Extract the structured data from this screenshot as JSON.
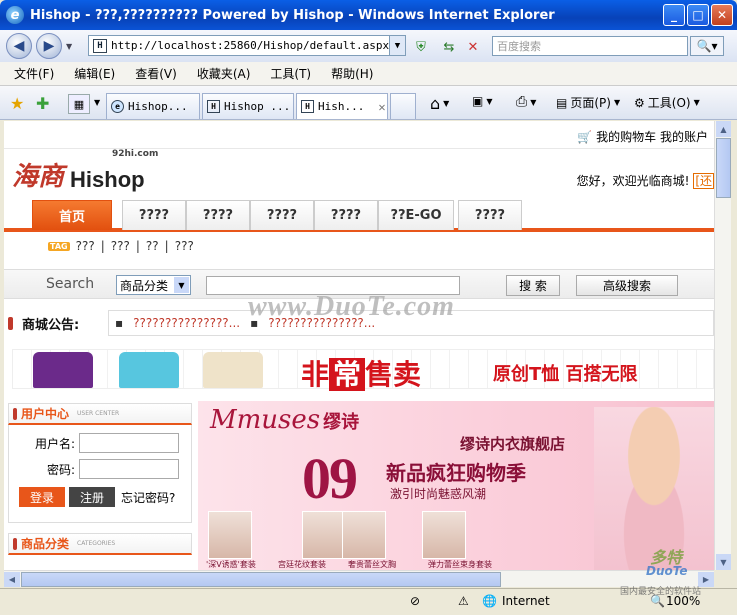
{
  "window": {
    "title": "Hishop - ???,?????????? Powered by Hishop - Windows Internet Explorer",
    "buttons": [
      "_",
      "□",
      "✕"
    ]
  },
  "address_bar": {
    "url": "http://localhost:25860/Hishop/default.aspx",
    "search_placeholder": "百度搜索"
  },
  "menu": [
    "文件(F)",
    "编辑(E)",
    "查看(V)",
    "收藏夹(A)",
    "工具(T)",
    "帮助(H)"
  ],
  "tabs": [
    {
      "label": "Hishop..."
    },
    {
      "label": "Hishop ..."
    },
    {
      "label": "Hish..."
    }
  ],
  "toolbar": {
    "page_label": "页面(P)",
    "tools_label": "工具(O)"
  },
  "site": {
    "top_links": {
      "cart": "我的购物车",
      "account": "我的账户"
    },
    "logo": {
      "cn": "海商",
      "en": "Hishop",
      "domain": "92hi.com"
    },
    "welcome": "您好，欢迎光临商城!",
    "welcome_cut": "[还",
    "nav": [
      "首页",
      "????",
      "????",
      "????",
      "????",
      "??E-GO",
      "????"
    ],
    "tag_badge": "TAG",
    "tags": [
      "???",
      "???",
      "??",
      "???"
    ],
    "search": {
      "label": "Search",
      "category": "商品分类",
      "search_button": "搜 索",
      "advanced_button": "高级搜索"
    },
    "notice": {
      "title": "商城公告:",
      "items": [
        "???????????????...",
        "???????????????..."
      ]
    },
    "banner1": {
      "main": "非",
      "boxed": "常",
      "tail": "售卖",
      "sub": "原创T恤  百搭无限"
    },
    "user_center": {
      "title": "用户中心",
      "title_en": "USER CENTER",
      "username_label": "用户名:",
      "password_label": "密码:",
      "login_button": "登录",
      "register_button": "注册",
      "forgot": "忘记密码?"
    },
    "categories": {
      "title": "商品分类",
      "title_en": "CATEGORIES"
    },
    "promo": {
      "brand": "Mmuses",
      "brand_cn": "缪诗",
      "store": "缪诗内衣旗舰店",
      "big": "09",
      "headline": "新品疯狂购物季",
      "sub": "激引时尚魅惑风潮",
      "captions": [
        "'深V诱惑'套装",
        "宫廷花纹套装",
        "奢贵蕾丝文胸",
        "弹力蕾丝束身套装"
      ]
    },
    "watermark": "www.DuoTe.com"
  },
  "status": {
    "zone": "Internet",
    "zoom": "100%"
  },
  "corner_watermark": {
    "cn": "多特",
    "en": "DuoTe",
    "sub": "国内最安全的软件站"
  }
}
